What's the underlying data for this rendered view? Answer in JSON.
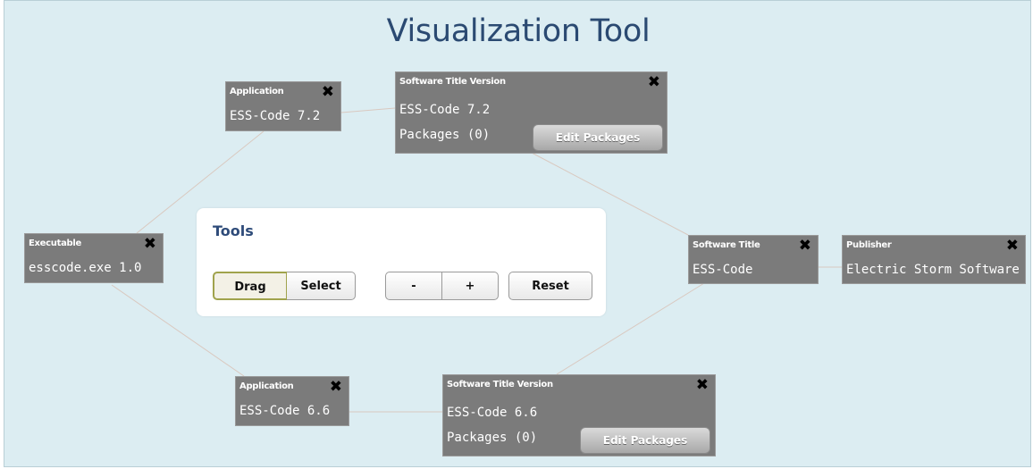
{
  "page": {
    "title": "Visualization Tool"
  },
  "nodes": {
    "app_72": {
      "type": "Application",
      "lines": [
        "ESS-Code 7.2"
      ]
    },
    "stv_72": {
      "type": "Software Title Version",
      "lines": [
        "ESS-Code 7.2",
        "Packages (0)"
      ],
      "button": "Edit Packages"
    },
    "executable": {
      "type": "Executable",
      "lines": [
        "esscode.exe 1.0"
      ]
    },
    "software_title": {
      "type": "Software Title",
      "lines": [
        "ESS-Code"
      ]
    },
    "publisher": {
      "type": "Publisher",
      "lines": [
        "Electric Storm Software"
      ]
    },
    "app_66": {
      "type": "Application",
      "lines": [
        "ESS-Code 6.6"
      ]
    },
    "stv_66": {
      "type": "Software Title Version",
      "lines": [
        "ESS-Code 6.6",
        "Packages (0)"
      ],
      "button": "Edit Packages"
    }
  },
  "close_glyph": "✖",
  "tools": {
    "title": "Tools",
    "drag": "Drag",
    "select": "Select",
    "zoom_out": "-",
    "zoom_in": "+",
    "reset": "Reset",
    "active_mode": "Drag"
  },
  "colors": {
    "canvas_bg": "#dcedf2",
    "node_bg": "#7b7b7b",
    "edge": "#d9c9c0",
    "title": "#2b4a72"
  }
}
